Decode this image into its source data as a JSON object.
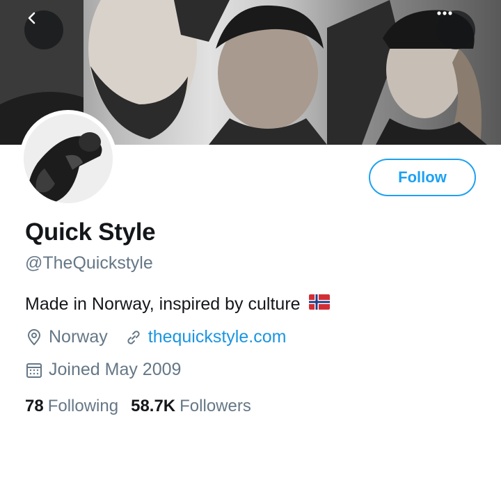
{
  "header": {
    "back_icon": "chevron-left-icon",
    "more_icon": "ellipsis-icon",
    "overlay_color": "#14171a"
  },
  "profile": {
    "display_name": "Quick Style",
    "handle": "@TheQuickstyle",
    "bio": "Made in Norway, inspired by culture",
    "bio_flag": "norway-flag-icon",
    "location": "Norway",
    "location_icon": "location-pin-icon",
    "website": "thequickstyle.com",
    "website_icon": "link-icon",
    "joined": "Joined May 2009",
    "joined_icon": "calendar-icon"
  },
  "actions": {
    "follow_label": "Follow",
    "accent_color": "#1da1f2"
  },
  "stats": {
    "following_count": "78",
    "following_label": "Following",
    "followers_count": "58.7K",
    "followers_label": "Followers"
  }
}
